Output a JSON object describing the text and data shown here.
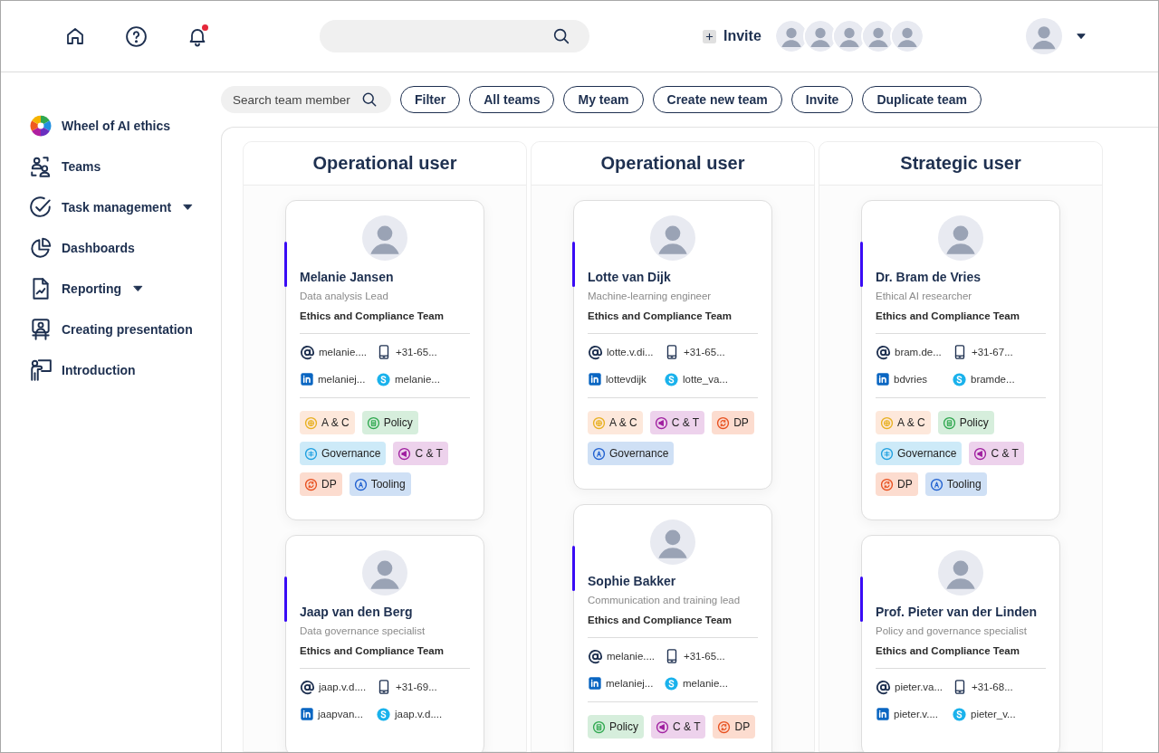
{
  "header": {
    "notifications_unread": true,
    "invite_label": "Invite"
  },
  "sidebar": {
    "items": [
      {
        "label": "Wheel of AI ethics",
        "dropdown": false
      },
      {
        "label": "Teams",
        "dropdown": false
      },
      {
        "label": "Task management",
        "dropdown": true
      },
      {
        "label": "Dashboards",
        "dropdown": false
      },
      {
        "label": "Reporting",
        "dropdown": true
      },
      {
        "label": "Creating presentation",
        "dropdown": false
      },
      {
        "label": "Introduction",
        "dropdown": false
      }
    ]
  },
  "toolbar": {
    "search": {
      "placeholder": "Search team member"
    },
    "buttons": [
      "Filter",
      "All teams",
      "My team",
      "Create new team",
      "Invite",
      "Duplicate team"
    ]
  },
  "columns": [
    {
      "title": "Operational user",
      "cards": [
        {
          "name": "Melanie Jansen",
          "role": "Data analysis Lead",
          "team": "Ethics and Compliance Team",
          "email": "melanie....",
          "phone": "+31-65...",
          "linkedin": "melaniej...",
          "skype": "melanie...",
          "tags": [
            {
              "label": "A & C",
              "kind": "ac"
            },
            {
              "label": "Policy",
              "kind": "policy"
            },
            {
              "label": "Governance",
              "kind": "governance"
            },
            {
              "label": "C & T",
              "kind": "ct"
            },
            {
              "label": "DP",
              "kind": "dp"
            },
            {
              "label": "Tooling",
              "kind": "tooling"
            }
          ]
        },
        {
          "name": "Jaap van den Berg",
          "role": "Data governance specialist",
          "team": "Ethics and Compliance Team",
          "email": "jaap.v.d....",
          "phone": "+31-69...",
          "linkedin": "jaapvan...",
          "skype": "jaap.v.d...."
        }
      ]
    },
    {
      "title": "Operational user",
      "cards": [
        {
          "name": "Lotte van Dijk",
          "role": "Machine-learning engineer",
          "team": "Ethics and Compliance Team",
          "email": "lotte.v.di...",
          "phone": "+31-65...",
          "linkedin": "lottevdijk",
          "skype": "lotte_va...",
          "tags": [
            {
              "label": "A & C",
              "kind": "ac"
            },
            {
              "label": "C & T",
              "kind": "ct"
            },
            {
              "label": "DP",
              "kind": "dp"
            },
            {
              "label": "Governance",
              "kind": "tooling"
            }
          ]
        },
        {
          "name": "Sophie Bakker",
          "role": "Communication and training lead",
          "team": "Ethics and Compliance Team",
          "email": "melanie....",
          "phone": "+31-65...",
          "linkedin": "melaniej...",
          "skype": "melanie...",
          "tags": [
            {
              "label": "Policy",
              "kind": "policy"
            },
            {
              "label": "C & T",
              "kind": "ct"
            },
            {
              "label": "DP",
              "kind": "dp"
            }
          ]
        }
      ]
    },
    {
      "title": "Strategic user",
      "cards": [
        {
          "name": "Dr. Bram de Vries",
          "role": "Ethical AI researcher",
          "team": "Ethics and Compliance Team",
          "email": "bram.de...",
          "phone": "+31-67...",
          "linkedin": "bdvries",
          "skype": "bramde...",
          "tags": [
            {
              "label": "A & C",
              "kind": "ac"
            },
            {
              "label": "Policy",
              "kind": "policy"
            },
            {
              "label": "Governance",
              "kind": "governance"
            },
            {
              "label": "C & T",
              "kind": "ct"
            },
            {
              "label": "DP",
              "kind": "dp"
            },
            {
              "label": "Tooling",
              "kind": "tooling"
            }
          ]
        },
        {
          "name": "Prof. Pieter van der Linden",
          "role": "Policy and governance specialist",
          "team": "Ethics and Compliance Team",
          "email": "pieter.va...",
          "phone": "+31-68...",
          "linkedin": "pieter.v....",
          "skype": "pieter_v..."
        }
      ]
    }
  ]
}
